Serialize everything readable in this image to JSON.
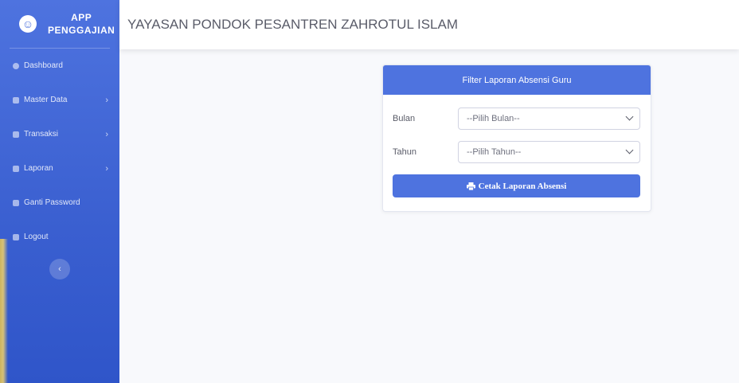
{
  "sidebar": {
    "brand_line1": "APP",
    "brand_line2": "PENGGAJIAN",
    "items": [
      {
        "label": "Dashboard",
        "icon": "dashboard-icon",
        "has_submenu": false
      },
      {
        "label": "Master Data",
        "icon": "database-icon",
        "has_submenu": true
      },
      {
        "label": "Transaksi",
        "icon": "table-icon",
        "has_submenu": true
      },
      {
        "label": "Laporan",
        "icon": "file-icon",
        "has_submenu": true
      },
      {
        "label": "Ganti Password",
        "icon": "lock-icon",
        "has_submenu": false
      },
      {
        "label": "Logout",
        "icon": "logout-icon",
        "has_submenu": false
      }
    ],
    "chevron": "›",
    "toggle_symbol": "‹"
  },
  "topbar": {
    "title": "YAYASAN PONDOK PESANTREN ZAHROTUL ISLAM"
  },
  "card": {
    "title": "Filter Laporan Absensi Guru",
    "bulan_label": "Bulan",
    "bulan_value": "--Pilih Bulan--",
    "tahun_label": "Tahun",
    "tahun_value": "--Pilih Tahun--",
    "button_label": "Cetak Laporan Absensi"
  },
  "colors": {
    "primary": "#4e73df",
    "page_bg": "#f8f9fc"
  }
}
